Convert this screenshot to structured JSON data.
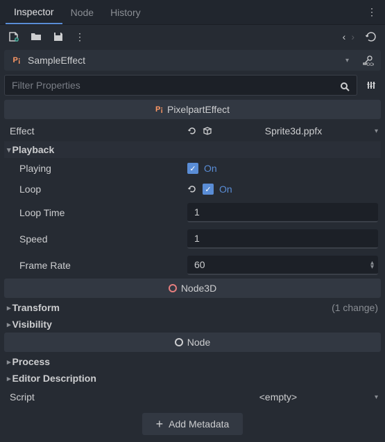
{
  "tabs": {
    "inspector": "Inspector",
    "node": "Node",
    "history": "History"
  },
  "node": {
    "name": "SampleEffect"
  },
  "filter": {
    "placeholder": "Filter Properties"
  },
  "section": {
    "pixelpart": "PixelpartEffect",
    "node3d": "Node3D",
    "node": "Node"
  },
  "effect": {
    "label": "Effect",
    "value": "Sprite3d.ppfx"
  },
  "playback": {
    "label": "Playback",
    "playing": {
      "label": "Playing",
      "state": "On"
    },
    "loop": {
      "label": "Loop",
      "state": "On"
    },
    "loopTime": {
      "label": "Loop Time",
      "value": "1"
    },
    "speed": {
      "label": "Speed",
      "value": "1"
    },
    "frameRate": {
      "label": "Frame Rate",
      "value": "60"
    }
  },
  "cats": {
    "transform": "Transform",
    "transformChange": "(1 change)",
    "visibility": "Visibility",
    "process": "Process",
    "editorDesc": "Editor Description"
  },
  "script": {
    "label": "Script",
    "value": "<empty>"
  },
  "metadata": {
    "label": "Add Metadata"
  }
}
